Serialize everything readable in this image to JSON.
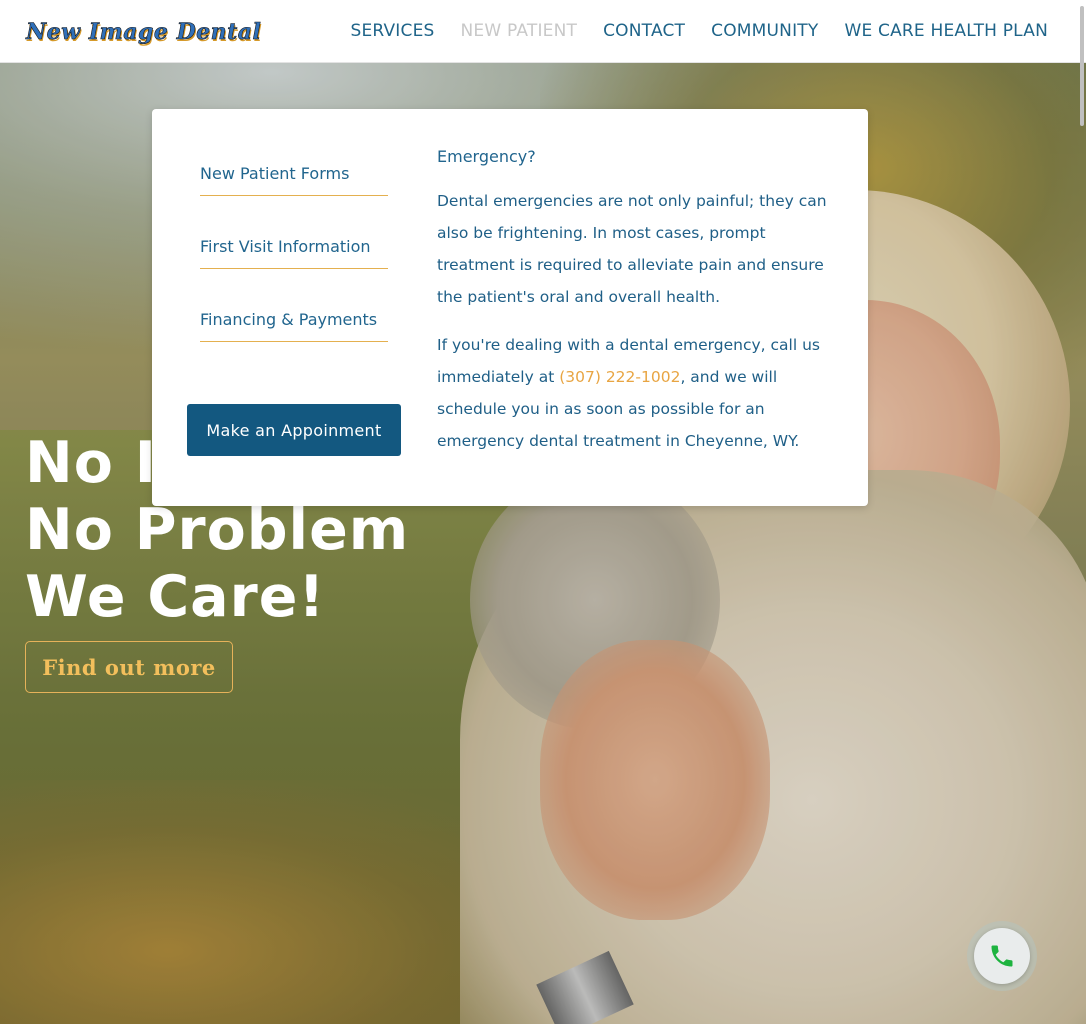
{
  "header": {
    "logo_text": "New Image Dental",
    "nav": [
      {
        "label": "SERVICES",
        "active": false
      },
      {
        "label": "NEW PATIENT",
        "active": true
      },
      {
        "label": "CONTACT",
        "active": false
      },
      {
        "label": "COMMUNITY",
        "active": false
      },
      {
        "label": "WE CARE HEALTH PLAN",
        "active": false
      }
    ]
  },
  "dropdown": {
    "links": [
      "New Patient Forms",
      "First Visit Information",
      "Financing & Payments"
    ],
    "appointment_button": "Make an Appoinment",
    "emergency_title": "Emergency?",
    "paragraph1": "Dental emergencies are not only painful; they can also be frightening. In most cases, prompt treatment is required to alleviate pain and ensure the patient's oral and overall health.",
    "paragraph2_before": "If you're dealing with a dental emergency, call us immediately at ",
    "phone": "(307) 222-1002",
    "paragraph2_after": ", and we will schedule you in as soon as possible for an emergency dental treatment in Cheyenne, WY."
  },
  "hero": {
    "line1": "No Insurance?",
    "line2": "No Problem",
    "line3": "We Care!",
    "cta": "Find out more"
  },
  "call_widget": {
    "icon": "phone-icon"
  },
  "colors": {
    "nav_text": "#1f6489",
    "nav_active": "#c8c8c8",
    "link_underline": "#e4b04f",
    "button_bg": "#135880",
    "phone_link": "#e8a543",
    "cta_text": "#f3bf5c",
    "phone_icon": "#1db33f"
  }
}
